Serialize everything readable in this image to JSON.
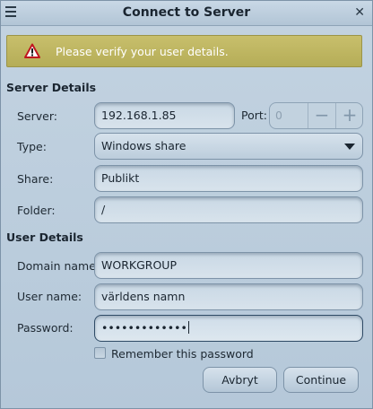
{
  "window": {
    "title": "Connect to Server"
  },
  "infobar": {
    "message": "Please verify your user details."
  },
  "server_details": {
    "header": "Server Details",
    "server_label": "Server:",
    "server_value": "192.168.1.85",
    "port_label": "Port:",
    "port_value": "0",
    "port_minus": "−",
    "port_plus": "+",
    "type_label": "Type:",
    "type_value": "Windows share",
    "share_label": "Share:",
    "share_value": "Publikt",
    "folder_label": "Folder:",
    "folder_value": "/"
  },
  "user_details": {
    "header": "User Details",
    "domain_label": "Domain name:",
    "domain_value": "WORKGROUP",
    "user_label": "User name:",
    "user_value": "världens namn",
    "password_label": "Password:",
    "password_value": "•••••••••••••",
    "remember_label": "Remember this password",
    "remember_checked": false
  },
  "buttons": {
    "cancel": "Avbryt",
    "continue": "Continue"
  },
  "icons": {
    "menu": "hamburger-menu-icon",
    "close": "close-icon",
    "warning": "warning-icon"
  },
  "colors": {
    "window_bg": "#bccddc",
    "infobar_bg": "#beb661",
    "warning_red": "#c0161e"
  }
}
